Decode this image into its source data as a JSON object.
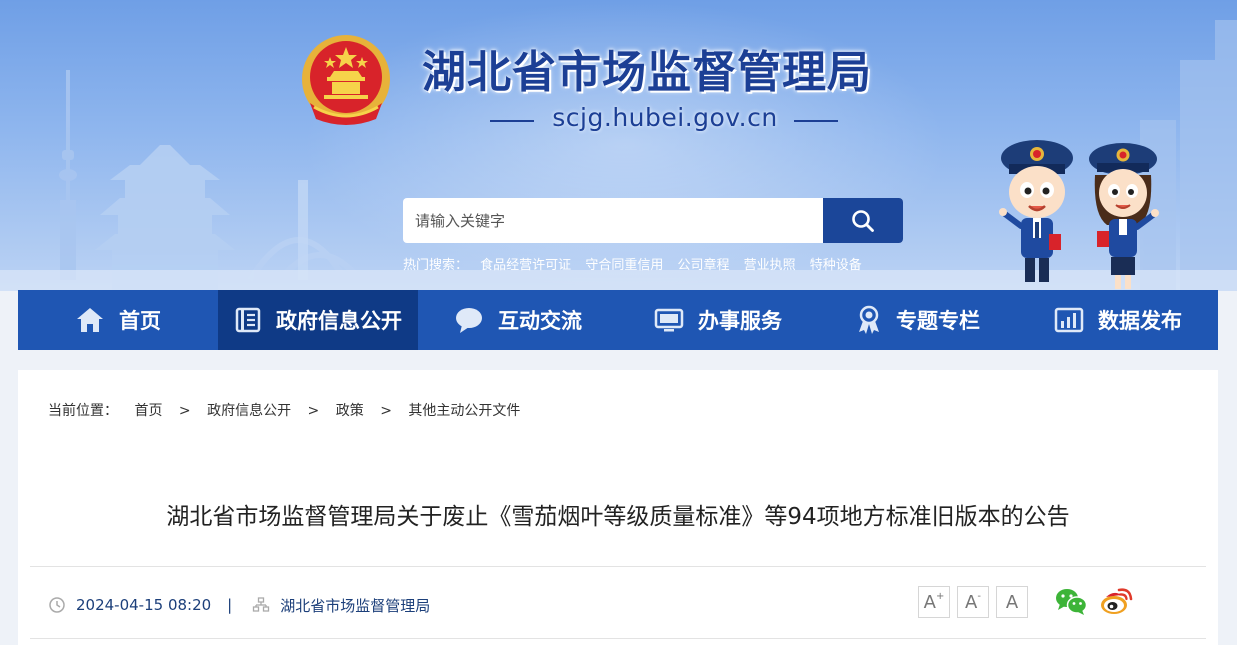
{
  "header": {
    "site_title": "湖北省市场监督管理局",
    "site_domain": "scjg.hubei.gov.cn"
  },
  "search": {
    "placeholder": "请输入关键字",
    "hot_label": "热门搜索：",
    "hot_links": [
      "食品经营许可证",
      "守合同重信用",
      "公司章程",
      "营业执照",
      "特种设备"
    ]
  },
  "nav": [
    {
      "label": "首页",
      "icon": "home-icon"
    },
    {
      "label": "政府信息公开",
      "icon": "document-list-icon",
      "active": true
    },
    {
      "label": "互动交流",
      "icon": "chat-bubble-icon"
    },
    {
      "label": "办事服务",
      "icon": "monitor-icon"
    },
    {
      "label": "专题专栏",
      "icon": "ribbon-badge-icon"
    },
    {
      "label": "数据发布",
      "icon": "bar-chart-icon"
    }
  ],
  "breadcrumb": {
    "label": "当前位置：",
    "items": [
      "首页",
      "政府信息公开",
      "政策",
      "其他主动公开文件"
    ],
    "separator": ">"
  },
  "article": {
    "title": "湖北省市场监督管理局关于废止《雪茄烟叶等级质量标准》等94项地方标准旧版本的公告",
    "datetime": "2024-04-15 08:20",
    "divider": "|",
    "source": "湖北省市场监督管理局"
  },
  "font_size_buttons": {
    "larger": "A",
    "larger_sup": "+",
    "smaller": "A",
    "smaller_sup": "-",
    "default": "A"
  },
  "share": [
    "wechat-icon",
    "weibo-icon"
  ],
  "colors": {
    "nav_bg": "#1f56b3",
    "nav_active_bg": "#0f3a86",
    "title_blue": "#1c3f95",
    "search_button": "#1b4699"
  }
}
